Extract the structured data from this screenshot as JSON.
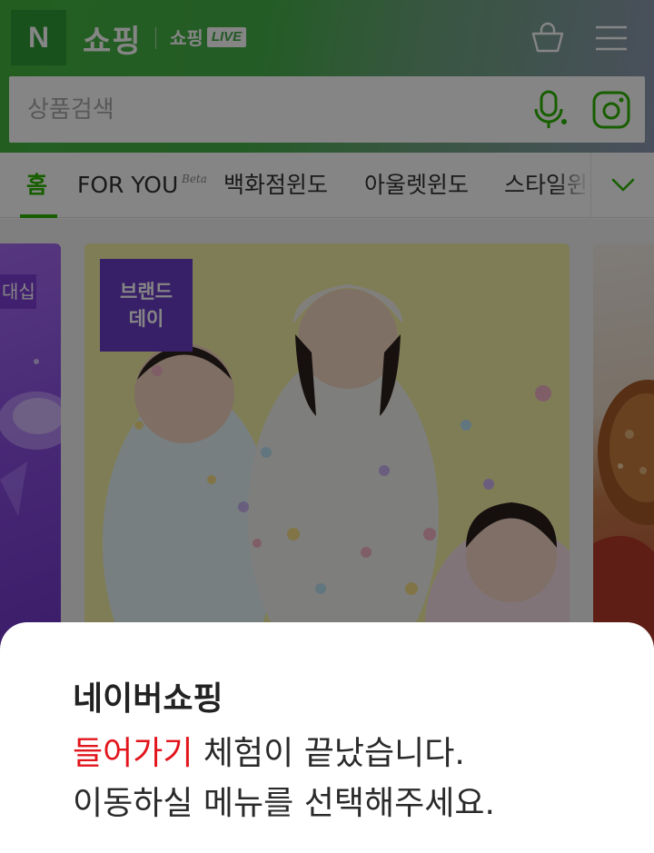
{
  "header": {
    "logo_text": "N",
    "title": "쇼핑",
    "live_shop": "쇼핑",
    "live_badge": "LIVE",
    "cart_icon": "shopping-bag-icon",
    "menu_icon": "hamburger-menu-icon",
    "brand_color": "#03c75a"
  },
  "search": {
    "placeholder": "상품검색",
    "value": "",
    "mic_icon": "microphone-icon",
    "lens_icon": "camera-lens-icon"
  },
  "tabs": {
    "items": [
      {
        "label": "홈",
        "active": true
      },
      {
        "label": "FOR YOU",
        "active": false
      },
      {
        "label": "백화점윈도",
        "active": false
      },
      {
        "label": "아울렛윈도",
        "active": false
      },
      {
        "label": "스타일윈",
        "active": false
      }
    ],
    "beta_label": "Beta",
    "expand_icon": "chevron-down-icon",
    "active_color": "#2db400"
  },
  "banners": {
    "left_badge": "대십",
    "main_badge_line1": "브랜드",
    "main_badge_line2": "데이"
  },
  "sheet": {
    "title": "네이버쇼핑",
    "highlight": "들어가기",
    "line1_rest": " 체험이 끝났습니다.",
    "line2": "이동하실 메뉴를 선택해주세요.",
    "highlight_color": "#e2151c"
  }
}
